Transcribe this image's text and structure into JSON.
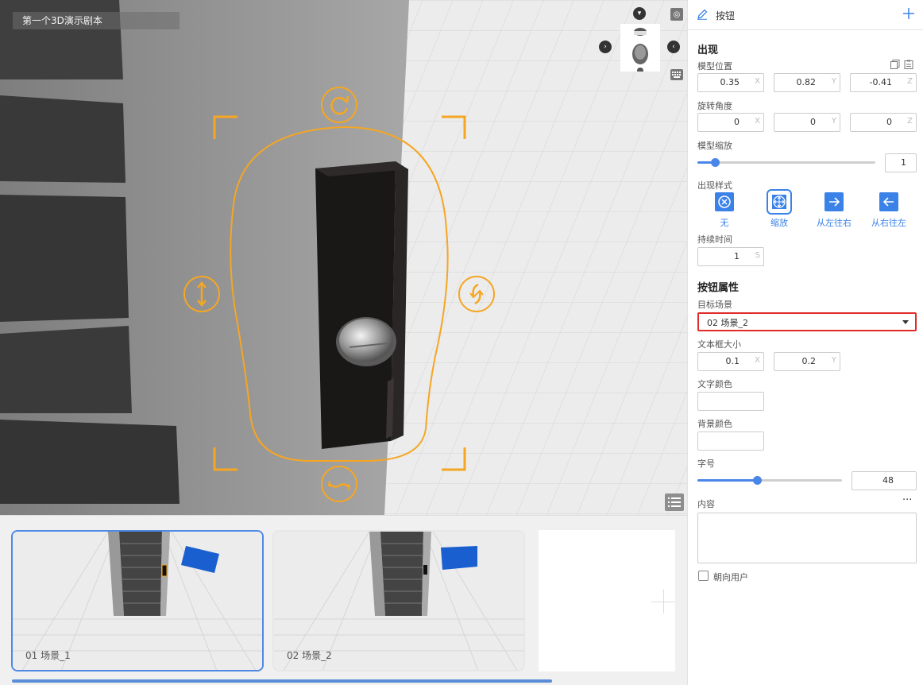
{
  "viewport": {
    "project_title": "第一个3D演示剧本"
  },
  "scenes": [
    {
      "name": "01  场景_1",
      "selected": true
    },
    {
      "name": "02  场景_2",
      "selected": false
    }
  ],
  "panel": {
    "header_title": "按钮",
    "appear": {
      "section_title": "出现",
      "position_label": "模型位置",
      "position": {
        "x": "0.35",
        "y": "0.82",
        "z": "-0.41"
      },
      "rotation_label": "旋转角度",
      "rotation": {
        "x": "0",
        "y": "0",
        "z": "0"
      },
      "scale_label": "模型缩放",
      "scale_value": "1",
      "scale_fraction": 0.1,
      "style_label": "出现样式",
      "styles": [
        {
          "label": "无",
          "icon": "circle-x-icon"
        },
        {
          "label": "缩放",
          "icon": "move-arrows-icon"
        },
        {
          "label": "从左往右",
          "icon": "arrow-right-icon"
        },
        {
          "label": "从右往左",
          "icon": "arrow-left-icon"
        }
      ],
      "selected_style_index": 1,
      "duration_label": "持续时间",
      "duration_value": "1",
      "duration_unit": "S"
    },
    "button_props": {
      "section_title": "按钮属性",
      "target_label": "目标场景",
      "target_value": "02  场景_2",
      "textbox_label": "文本框大小",
      "textbox": {
        "x": "0.1",
        "y": "0.2"
      },
      "text_color_label": "文字颜色",
      "bg_color_label": "背景颜色",
      "font_size_label": "字号",
      "font_size_value": "48",
      "font_size_fraction": 0.41,
      "content_label": "内容",
      "content_more": "···",
      "face_user_label": "朝向用户"
    },
    "axis_labels": {
      "x": "X",
      "y": "Y",
      "z": "Z"
    }
  },
  "colors": {
    "accent": "#4a86e8",
    "gizmo": "#f5a623",
    "error_border": "#e12b2b"
  }
}
